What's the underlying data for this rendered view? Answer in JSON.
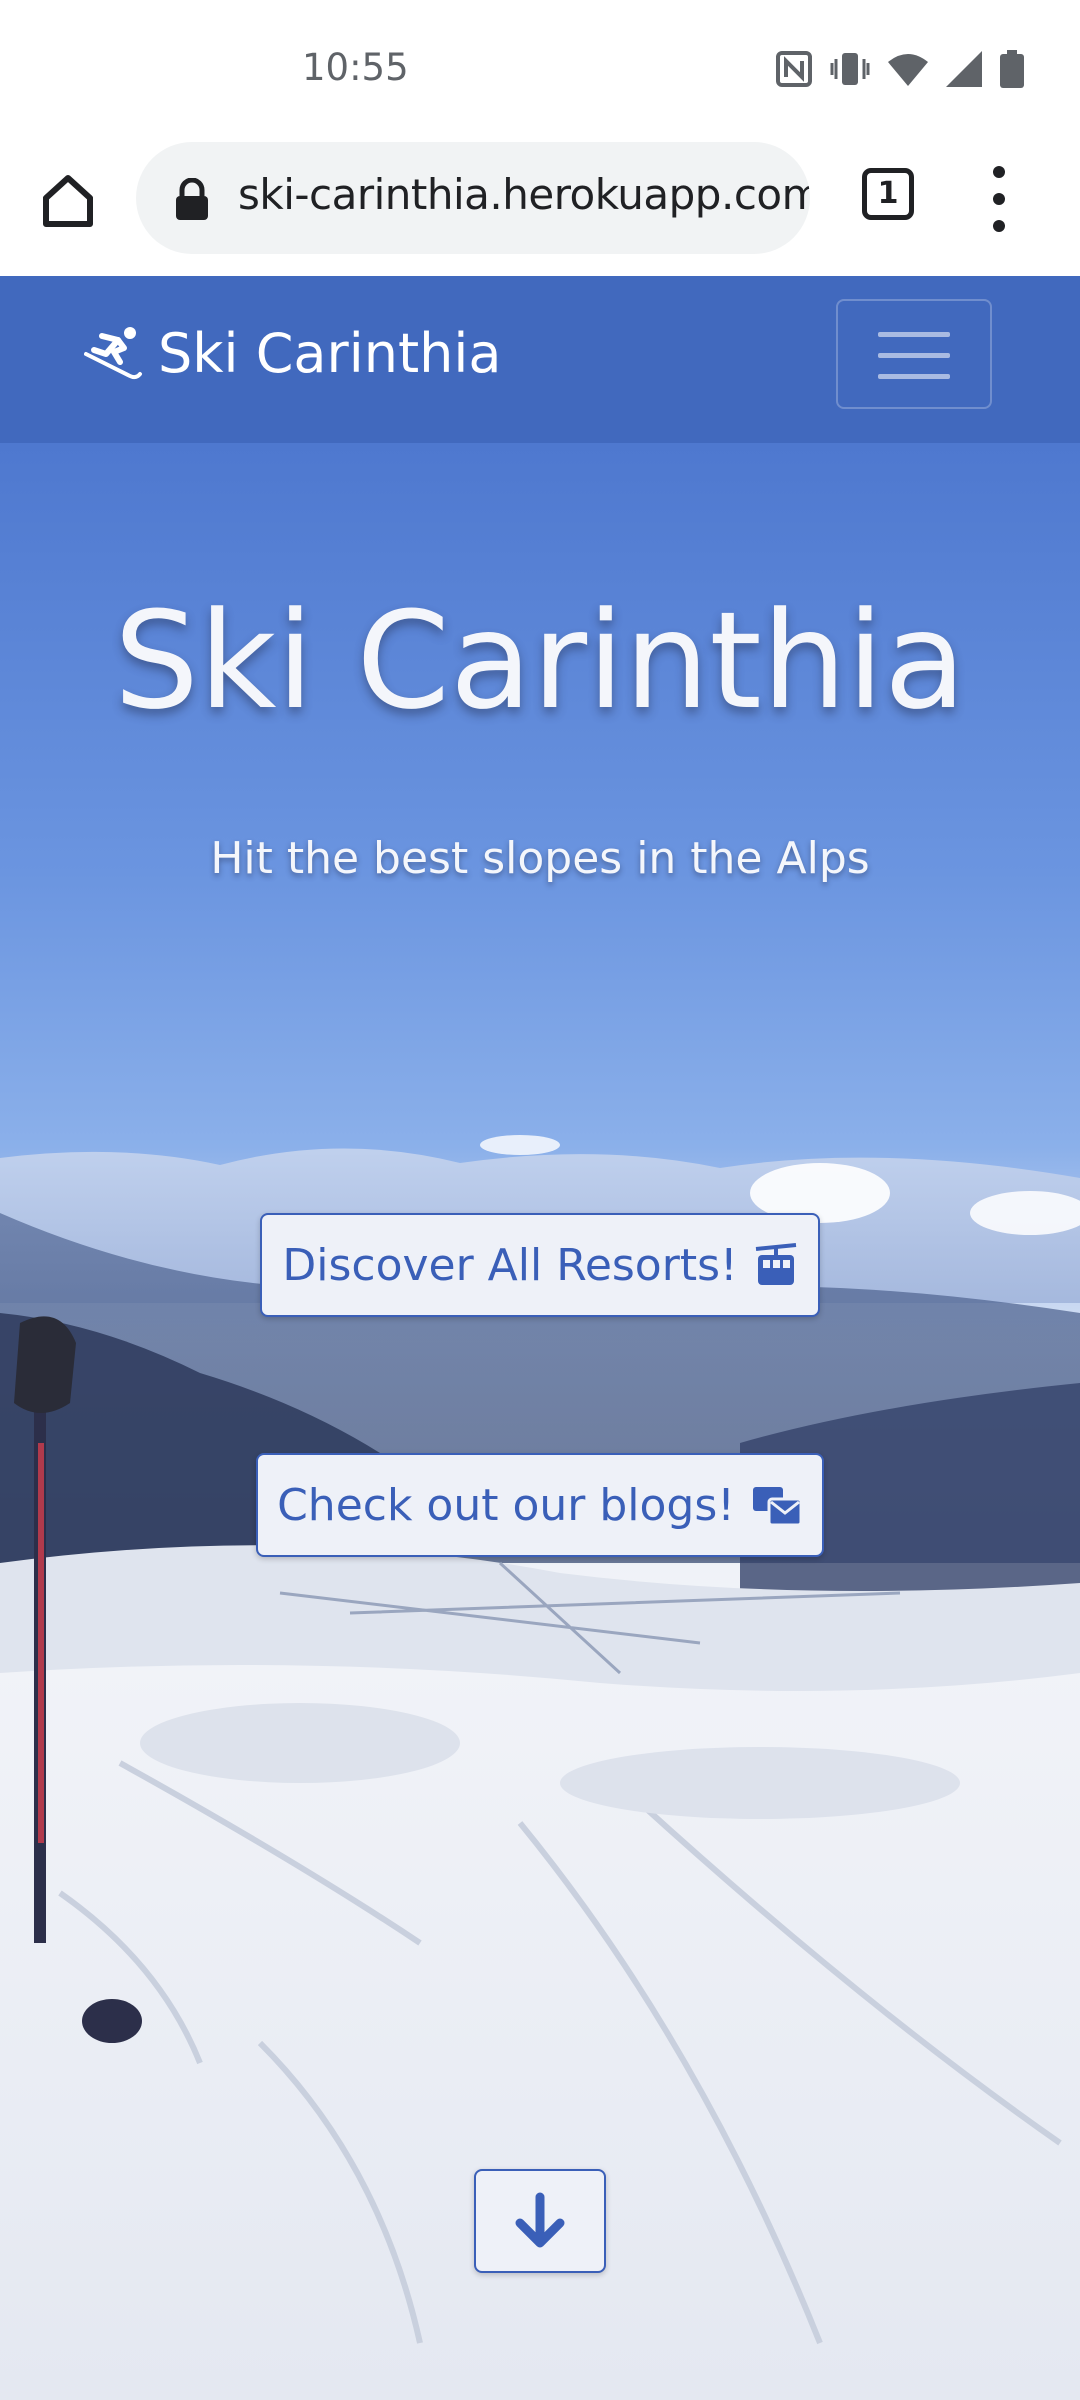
{
  "status_bar": {
    "time": "10:55",
    "icons": [
      "nfc-icon",
      "vibrate-icon",
      "wifi-icon",
      "signal-icon",
      "battery-icon"
    ]
  },
  "browser": {
    "url": "ski-carinthia.herokuapp.com",
    "tab_count": "1",
    "icons": [
      "home-icon",
      "lock-icon",
      "tabs-icon",
      "more-vert-icon"
    ]
  },
  "navbar": {
    "brand": "Ski Carinthia",
    "brand_icon": "skiing-icon",
    "toggle_icon": "hamburger-icon",
    "color": "#4169be"
  },
  "hero": {
    "title": "Ski Carinthia",
    "subtitle": "Hit the best slopes in the Alps",
    "buttons": [
      {
        "label": "Discover All Resorts!",
        "icon": "tram-icon"
      },
      {
        "label": "Check out our blogs!",
        "icon": "mail-bulk-icon"
      }
    ],
    "scroll_icon": "arrow-down-icon",
    "accent_color": "#3a5fb8"
  }
}
